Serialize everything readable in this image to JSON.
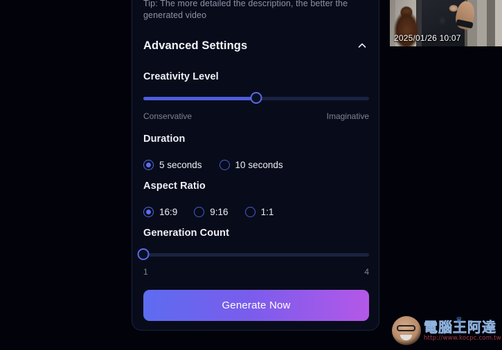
{
  "panel": {
    "tip": "Tip: The more detailed the description, the better the generated video",
    "advanced_settings_label": "Advanced Settings",
    "chevron_icon": "chevron-up-icon",
    "creativity": {
      "label": "Creativity Level",
      "value_percent": 50,
      "min_label": "Conservative",
      "max_label": "Imaginative"
    },
    "duration": {
      "label": "Duration",
      "options": [
        {
          "label": "5 seconds",
          "selected": true
        },
        {
          "label": "10 seconds",
          "selected": false
        }
      ]
    },
    "aspect_ratio": {
      "label": "Aspect Ratio",
      "options": [
        {
          "label": "16:9",
          "selected": true
        },
        {
          "label": "9:16",
          "selected": false
        },
        {
          "label": "1:1",
          "selected": false
        }
      ]
    },
    "generation_count": {
      "label": "Generation Count",
      "value": 1,
      "value_percent": 0,
      "min_label": "1",
      "max_label": "4"
    },
    "generate_button_label": "Generate Now"
  },
  "thumbnail": {
    "timestamp": "2025/01/26 10:07"
  },
  "watermark": {
    "title": "電腦王阿達",
    "url": "http://www.kocpc.com.tw",
    "crown": "♛"
  },
  "colors": {
    "background": "#02030a",
    "panel": "#080c1a",
    "panel_border": "#1b2440",
    "accent": "#5a6ae8",
    "slider_track": "#1a2340",
    "slider_fill": "#4f5dde",
    "button_gradient_start": "#5d6cf0",
    "button_gradient_end": "#b458e8",
    "text_primary": "#eef1f8",
    "text_muted": "#7d8498"
  }
}
